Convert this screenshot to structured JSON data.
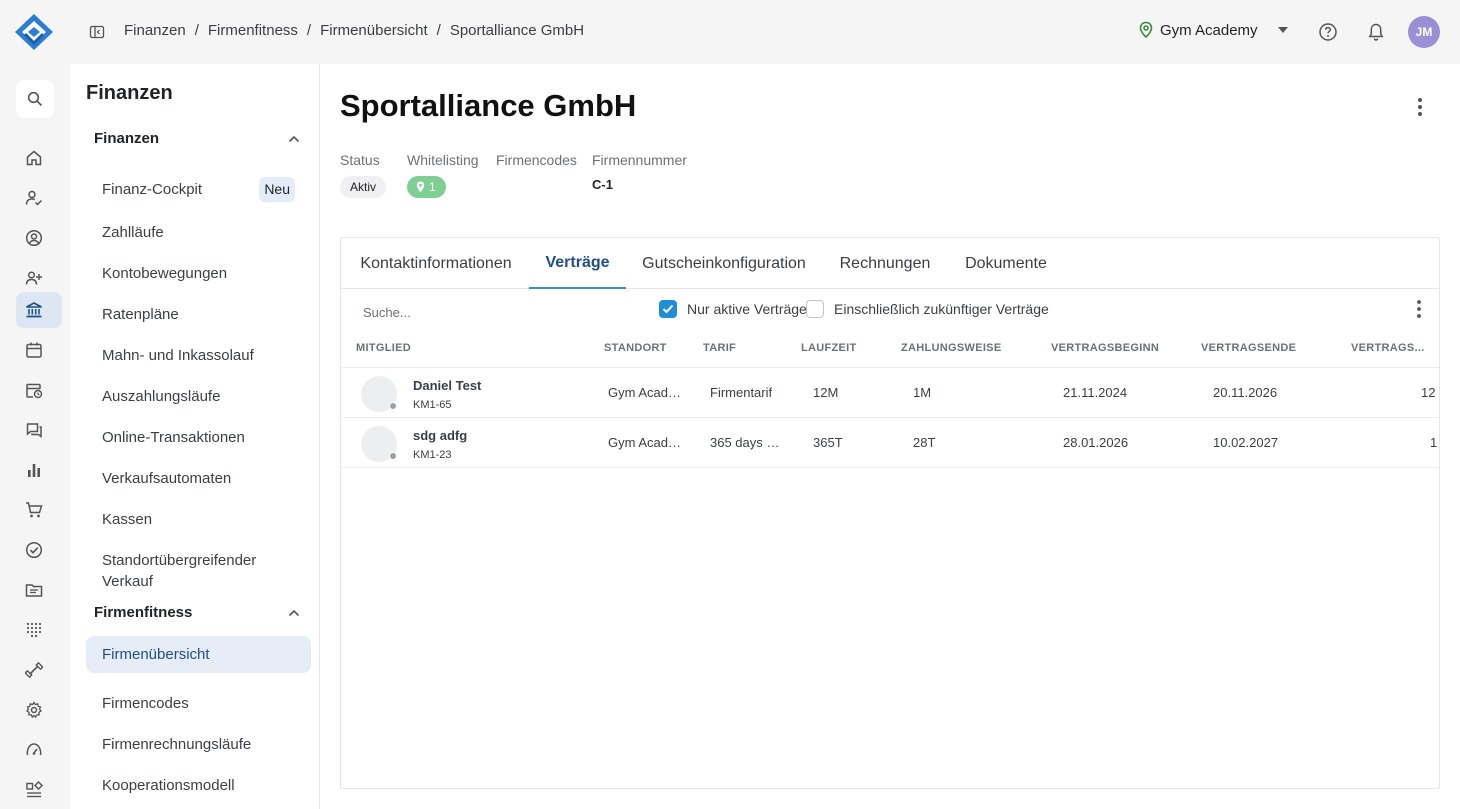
{
  "topbar": {
    "breadcrumb": [
      "Finanzen",
      "Firmenfitness",
      "Firmenübersicht",
      "Sportalliance GmbH"
    ],
    "breadcrumb_sep": "/",
    "studio": "Gym Academy",
    "user_initials": "JM"
  },
  "rail": {
    "icons": [
      "search-icon",
      "home-icon",
      "user-check-icon",
      "user-circle-icon",
      "user-add-icon",
      "bank-icon",
      "calendar-icon",
      "calendar-clock-icon",
      "chat-icon",
      "bar-chart-icon",
      "cart-icon",
      "check-circle-icon",
      "folder-icon",
      "dots-grid-icon",
      "dumbbell-icon",
      "gear-icon",
      "gauge-icon",
      "widgets-icon"
    ],
    "active": "bank-icon"
  },
  "subnav": {
    "title": "Finanzen",
    "groups": [
      {
        "label": "Finanzen",
        "items": [
          "Finanz-Cockpit",
          "Zahlläufe",
          "Kontobewegungen",
          "Ratenpläne",
          "Mahn- und Inkassolauf",
          "Auszahlungsläufe",
          "Online-Transaktionen",
          "Verkaufsautomaten",
          "Kassen",
          "Standortübergreifender Verkauf"
        ],
        "badge": "Neu"
      },
      {
        "label": "Firmenfitness",
        "items": [
          "Firmenübersicht",
          "Firmencodes",
          "Firmenrechnungsläufe",
          "Kooperationsmodell"
        ],
        "active": "Firmenübersicht"
      }
    ]
  },
  "page": {
    "title": "Sportalliance GmbH",
    "meta": {
      "status_label": "Status",
      "status_value": "Aktiv",
      "whitelisting_label": "Whitelisting",
      "whitelisting_value": "1",
      "firmencodes_label": "Firmencodes",
      "firmennummer_label": "Firmennummer",
      "firmennummer_value": "C-1"
    },
    "tabs": [
      "Kontaktinformationen",
      "Verträge",
      "Gutscheinkonfiguration",
      "Rechnungen",
      "Dokumente"
    ],
    "active_tab": "Verträge",
    "search_placeholder": "Suche...",
    "filters": {
      "only_active": {
        "label": "Nur aktive Verträge",
        "checked": true
      },
      "include_future": {
        "label": "Einschließlich zukünftiger Verträge",
        "checked": false
      }
    },
    "table": {
      "columns": [
        "MITGLIED",
        "STANDORT",
        "TARIF",
        "LAUFZEIT",
        "ZAHLUNGSWEISE",
        "VERTRAGSBEGINN",
        "VERTRAGSENDE",
        "VERTRAGS..."
      ],
      "rows": [
        {
          "name": "Daniel Test",
          "nr": "KM1-65",
          "standort": "Gym Acad…",
          "tarif": "Firmentarif",
          "laufzeit": "12M",
          "zahlungsweise": "1M",
          "beginn": "21.11.2024",
          "ende": "20.11.2026",
          "last": "12"
        },
        {
          "name": "sdg adfg",
          "nr": "KM1-23",
          "standort": "Gym Acad…",
          "tarif": "365 days …",
          "laufzeit": "365T",
          "zahlungsweise": "28T",
          "beginn": "28.01.2026",
          "ende": "10.02.2027",
          "last": "1"
        }
      ]
    }
  },
  "colors": {
    "accent": "#1f4f86",
    "tab_underline": "#3a8ed6",
    "checkbox": "#1f8ed6",
    "whitelisting_pill": "#7fcf95",
    "avatar": "#9b8fd6"
  }
}
